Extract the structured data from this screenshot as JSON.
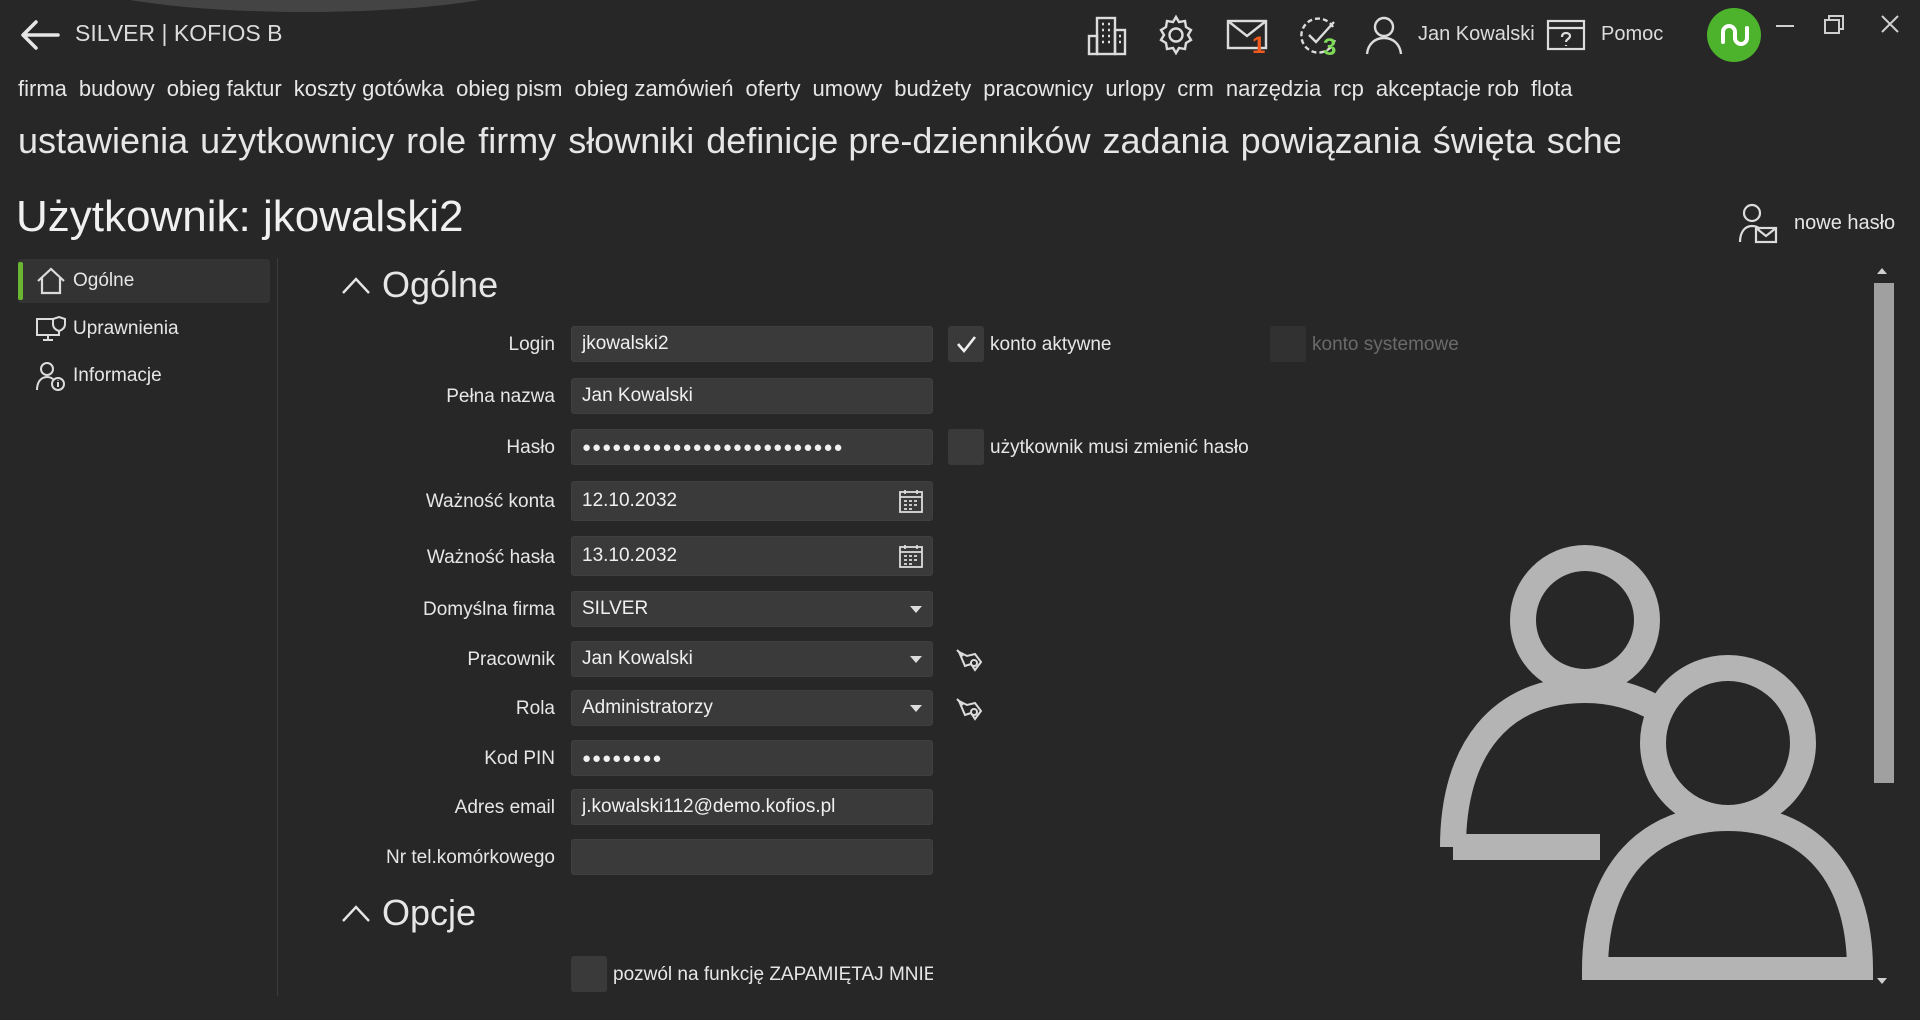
{
  "app": {
    "title": "SILVER | KOFIOS B",
    "user_name": "Jan Kowalski",
    "help_label": "Pomoc",
    "mail_count": "1",
    "tasks_count": "3"
  },
  "colors": {
    "background": "#272727",
    "accent_green": "#6ab633",
    "badge_mail": "#f05a1e",
    "badge_tasks": "#7ed957"
  },
  "menu_main": [
    "firma",
    "budowy",
    "obieg faktur",
    "koszty gotówka",
    "obieg pism",
    "obieg zamówień",
    "oferty",
    "umowy",
    "budżety",
    "pracownicy",
    "urlopy",
    "crm",
    "narzędzia",
    "rcp",
    "akceptacje rob",
    "flota"
  ],
  "menu_sub": [
    "ustawienia",
    "użytkownicy",
    "role",
    "firmy",
    "słowniki",
    "definicje pre-dzienników",
    "zadania",
    "powiązania",
    "święta",
    "schematy a"
  ],
  "page": {
    "title": "Użytkownik: jkowalski2",
    "new_password_label": "nowe hasło"
  },
  "nav": [
    {
      "label": "Ogólne",
      "icon": "home-icon",
      "active": true
    },
    {
      "label": "Uprawnienia",
      "icon": "monitor-shield-icon",
      "active": false
    },
    {
      "label": "Informacje",
      "icon": "user-info-icon",
      "active": false
    }
  ],
  "sections": {
    "general": "Ogólne",
    "options": "Opcje"
  },
  "form": {
    "login": {
      "label": "Login",
      "value": "jkowalski2"
    },
    "full_name": {
      "label": "Pełna nazwa",
      "value": "Jan Kowalski"
    },
    "password": {
      "label": "Hasło",
      "value": "●●●●●●●●●●●●●●●●●●●●●●●●●●"
    },
    "account_valid": {
      "label": "Ważność konta",
      "value": "12.10.2032"
    },
    "password_valid": {
      "label": "Ważność hasła",
      "value": "13.10.2032"
    },
    "default_company": {
      "label": "Domyślna firma",
      "value": "SILVER"
    },
    "employee": {
      "label": "Pracownik",
      "value": "Jan Kowalski"
    },
    "role": {
      "label": "Rola",
      "value": "Administratorzy"
    },
    "pin": {
      "label": "Kod PIN",
      "value": "●●●●●●●●"
    },
    "email": {
      "label": "Adres email",
      "value": "j.kowalski112@demo.kofios.pl"
    },
    "mobile": {
      "label": "Nr tel.komórkowego",
      "value": ""
    }
  },
  "checkboxes": {
    "active_account": {
      "label": "konto aktywne",
      "checked": true
    },
    "system_account": {
      "label": "konto systemowe",
      "checked": false
    },
    "must_change_password": {
      "label": "użytkownik musi zmienić hasło",
      "checked": false
    },
    "remember_me": {
      "label": "pozwól na funkcję ZAPAMIĘTAJ MNIE",
      "checked": false
    }
  }
}
